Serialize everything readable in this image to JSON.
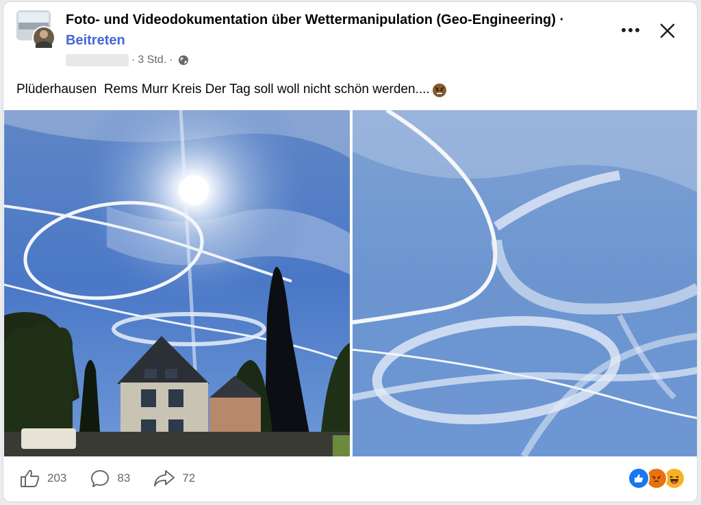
{
  "post": {
    "group_name": "Foto- und Videodokumentation über Wettermanipulation (Geo-Engineering) ·",
    "join_label": "Beitreten",
    "time": "3 Std.",
    "separator": "·",
    "text": "Plüderhausen  Rems Murr Kreis Der Tag soll woll nicht schön werden....",
    "emoji_icon": "angry-face-icon",
    "visibility_icon": "globe-icon"
  },
  "header_buttons": {
    "more_icon": "more-dots-icon",
    "close_icon": "close-icon"
  },
  "photos": [
    {
      "subject": "sky-with-contrails-sun-house-cypress"
    },
    {
      "subject": "sky-with-contrails"
    }
  ],
  "actions": {
    "like_count": "203",
    "comment_count": "83",
    "share_count": "72"
  },
  "reactions": [
    "like",
    "angry",
    "haha"
  ],
  "colors": {
    "link_blue": "#4267d6",
    "text": "#050505",
    "secondary": "#65676b",
    "sky": "#3f6fbf",
    "like_blue": "#1877f2",
    "angry_orange": "#e9710f",
    "haha_yellow": "#f7b125"
  }
}
